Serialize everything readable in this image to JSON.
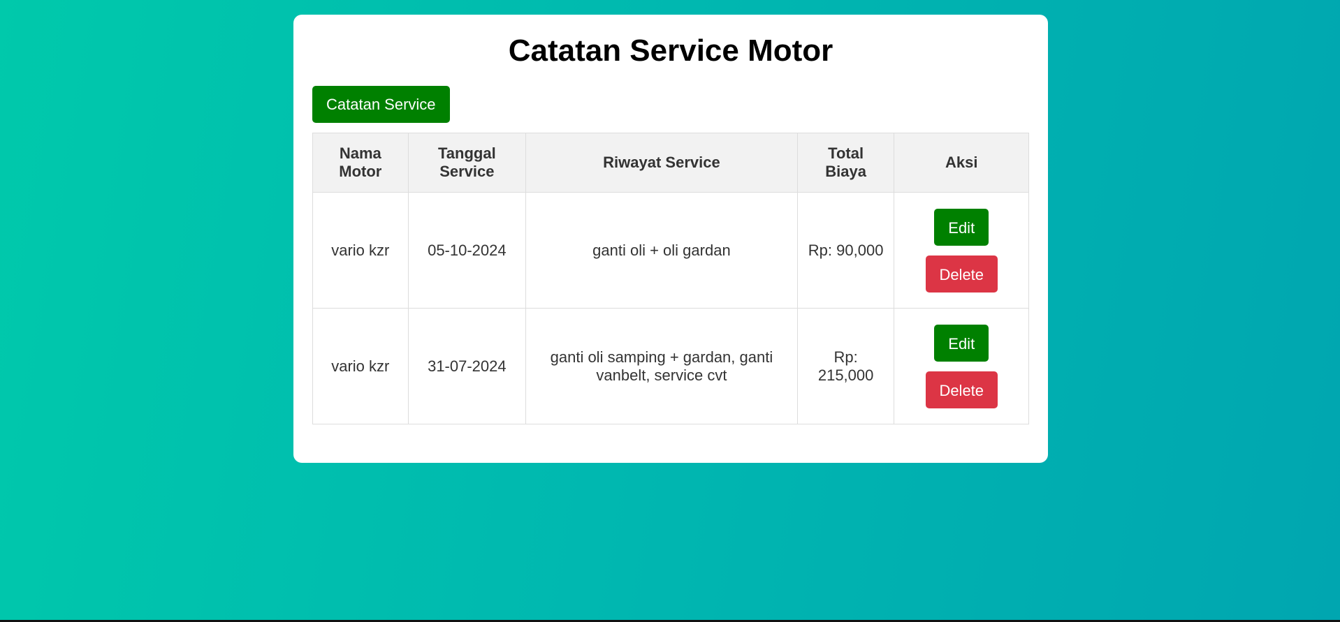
{
  "page": {
    "title": "Catatan Service Motor"
  },
  "toolbar": {
    "add_label": "Catatan Service"
  },
  "table": {
    "headers": [
      "Nama Motor",
      "Tanggal Service",
      "Riwayat Service",
      "Total Biaya",
      "Aksi"
    ],
    "rows": [
      {
        "nama_motor": "vario kzr",
        "tanggal": "05-10-2024",
        "riwayat": "ganti oli + oli gardan",
        "biaya": "Rp: 90,000",
        "edit_label": "Edit",
        "delete_label": "Delete"
      },
      {
        "nama_motor": "vario kzr",
        "tanggal": "31-07-2024",
        "riwayat": "ganti oli samping + gardan, ganti vanbelt, service cvt",
        "biaya": "Rp: 215,000",
        "edit_label": "Edit",
        "delete_label": "Delete"
      }
    ]
  },
  "colors": {
    "background_start": "#00c9ab",
    "background_end": "#00a6b0",
    "primary_green": "#008000",
    "danger_red": "#dc3545",
    "header_bg": "#f2f2f2"
  }
}
